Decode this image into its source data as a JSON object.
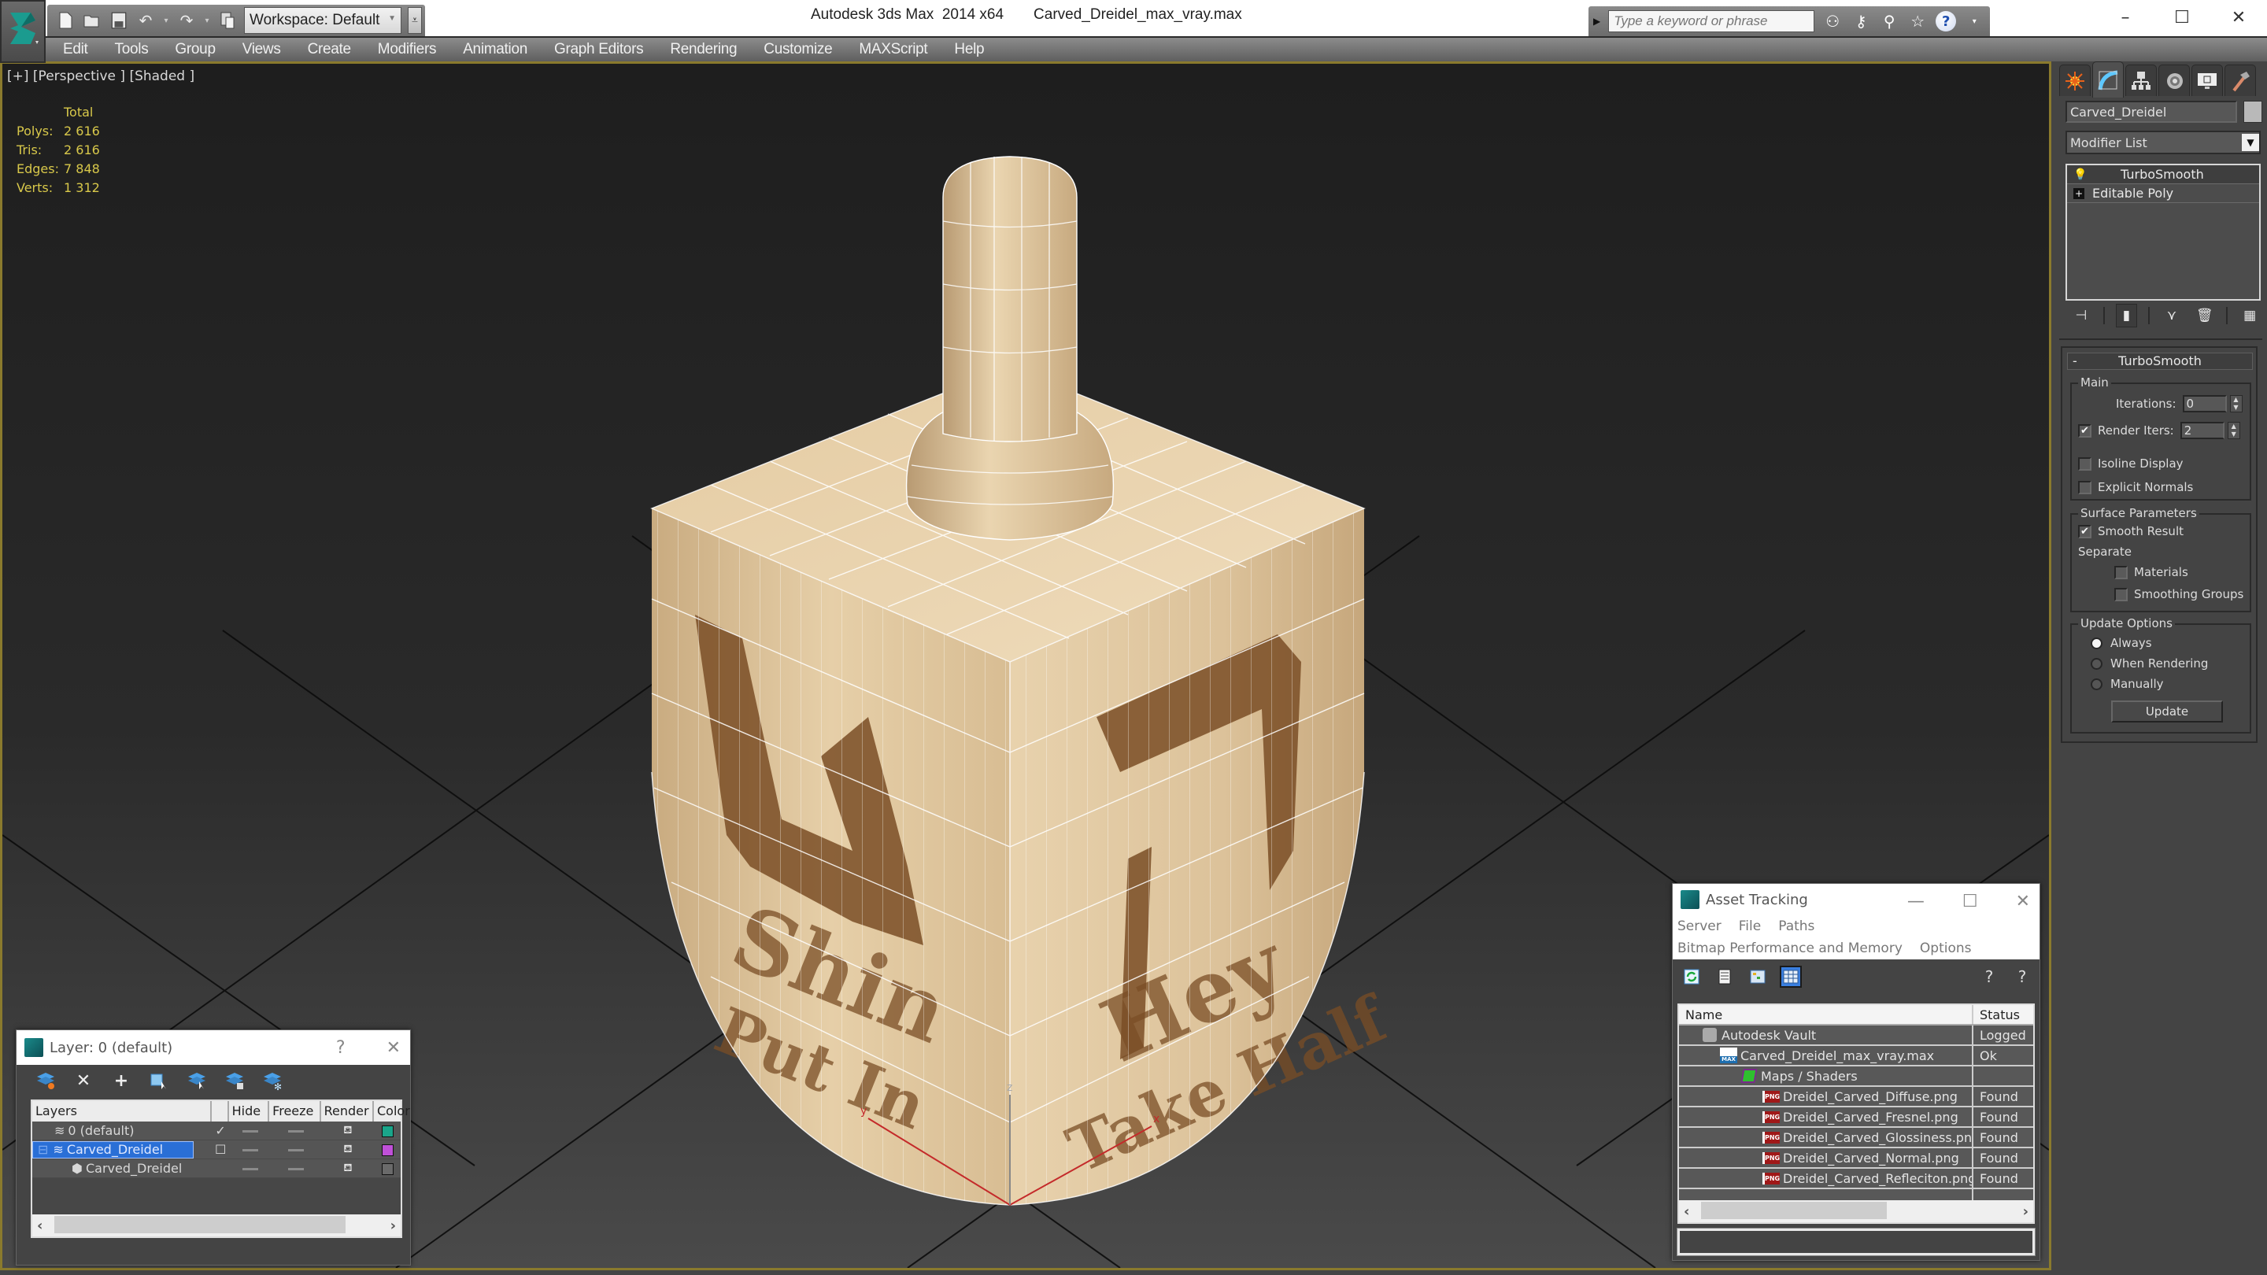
{
  "window": {
    "app_title": "Autodesk 3ds Max  2014 x64",
    "file_title": "Carved_Dreidel_max_vray.max",
    "controls": {
      "minimize": "–",
      "maximize": "☐",
      "close": "✕"
    }
  },
  "quick_access": {
    "workspace_label": "Workspace: Default",
    "icons": [
      "new-file-icon",
      "open-folder-icon",
      "save-icon",
      "undo-icon",
      "redo-icon",
      "project-folder-icon"
    ]
  },
  "search": {
    "placeholder": "Type a keyword or phrase",
    "icons": [
      "binoculars-icon",
      "key-icon",
      "satellite-icon",
      "star-icon",
      "help-icon"
    ]
  },
  "menu": [
    "Edit",
    "Tools",
    "Group",
    "Views",
    "Create",
    "Modifiers",
    "Animation",
    "Graph Editors",
    "Rendering",
    "Customize",
    "MAXScript",
    "Help"
  ],
  "viewport": {
    "label": "[+] [Perspective ] [Shaded ]",
    "stats": {
      "header": "Total",
      "rows": [
        {
          "label": "Polys:",
          "value": "2 616"
        },
        {
          "label": "Tris:",
          "value": "2 616"
        },
        {
          "label": "Edges:",
          "value": "7 848"
        },
        {
          "label": "Verts:",
          "value": "1 312"
        }
      ]
    },
    "model_face_text": {
      "left_title": "Shin",
      "left_sub": "Put In",
      "right_title": "Hey",
      "right_sub": "Take Half"
    },
    "gizmo_axes": {
      "x": "x",
      "y": "y",
      "z": "z"
    }
  },
  "command_panel": {
    "tabs": [
      "create-tab",
      "modify-tab",
      "hierarchy-tab",
      "motion-tab",
      "display-tab",
      "utilities-tab"
    ],
    "active_tab": 1,
    "object_name": "Carved_Dreidel",
    "object_color": "#b9b9b9",
    "modifier_list_label": "Modifier List",
    "stack": [
      {
        "label": "TurboSmooth",
        "selected": true
      },
      {
        "label": "Editable Poly",
        "selected": false
      }
    ],
    "rollout": {
      "title": "TurboSmooth",
      "collapse_symbol": "-",
      "main": {
        "title": "Main",
        "iterations_label": "Iterations:",
        "iterations_value": "0",
        "render_iters_label": "Render Iters:",
        "render_iters_checked": true,
        "render_iters_value": "2",
        "isoline_label": "Isoline Display",
        "isoline_checked": false,
        "explicit_normals_label": "Explicit Normals",
        "explicit_normals_checked": false
      },
      "surface": {
        "title": "Surface Parameters",
        "smooth_result_label": "Smooth Result",
        "smooth_result_checked": true,
        "separate_label": "Separate",
        "materials_label": "Materials",
        "materials_checked": false,
        "smoothing_groups_label": "Smoothing Groups",
        "smoothing_groups_checked": false
      },
      "update": {
        "title": "Update Options",
        "options": [
          "Always",
          "When Rendering",
          "Manually"
        ],
        "selected": "Always",
        "button_label": "Update"
      }
    }
  },
  "layer_dialog": {
    "title": "Layer: 0 (default)",
    "help": "?",
    "close": "✕",
    "toolbar_icons": [
      "create-layer-icon",
      "delete-layer-icon",
      "add-to-layer-icon",
      "select-objects-icon",
      "highlight-layer-icon",
      "hide-all-layers-icon",
      "freeze-all-layers-icon"
    ],
    "columns": [
      "Layers",
      "",
      "Hide",
      "Freeze",
      "Render",
      "Color"
    ],
    "rows": [
      {
        "name": "0 (default)",
        "current": "✓",
        "color": "#1aa58a",
        "selected": false,
        "indent": 1,
        "type": "layer"
      },
      {
        "name": "Carved_Dreidel",
        "current": "☐",
        "color": "#c050d8",
        "selected": true,
        "indent": 0,
        "type": "layer"
      },
      {
        "name": "Carved_Dreidel",
        "current": "",
        "color": "#6a6a6a",
        "selected": false,
        "indent": 2,
        "type": "object"
      }
    ]
  },
  "asset_dialog": {
    "title": "Asset Tracking",
    "menu_row1": [
      "Server",
      "File",
      "Paths"
    ],
    "menu_row2": [
      "Bitmap Performance and Memory",
      "Options"
    ],
    "toolbar_icons": [
      "refresh-icon",
      "list-view-icon",
      "tree-view-icon",
      "table-view-icon"
    ],
    "help_icons": [
      "vault-help-icon",
      "whats-this-icon"
    ],
    "columns": [
      "Name",
      "Status"
    ],
    "rows": [
      {
        "name": "Autodesk Vault",
        "status": "Logged Out",
        "type": "vault",
        "indent": 1
      },
      {
        "name": "Carved_Dreidel_max_vray.max",
        "status": "Ok",
        "type": "max",
        "indent": 2
      },
      {
        "name": "Maps / Shaders",
        "status": "",
        "type": "maps",
        "indent": 3
      },
      {
        "name": "Dreidel_Carved_Diffuse.png",
        "status": "Found",
        "type": "png",
        "indent": 4
      },
      {
        "name": "Dreidel_Carved_Fresnel.png",
        "status": "Found",
        "type": "png",
        "indent": 4
      },
      {
        "name": "Dreidel_Carved_Glossiness.png",
        "status": "Found",
        "type": "png",
        "indent": 4
      },
      {
        "name": "Dreidel_Carved_Normal.png",
        "status": "Found",
        "type": "png",
        "indent": 4
      },
      {
        "name": "Dreidel_Carved_Refleciton.png",
        "status": "Found",
        "type": "png",
        "indent": 4
      }
    ]
  },
  "colors": {
    "viewport_border": "#8a7a2d",
    "stats_text": "#d8c84a",
    "selection_blue": "#2a6fd6",
    "wood_light": "#e3c9a0",
    "wood_dark": "#7a4e26"
  }
}
